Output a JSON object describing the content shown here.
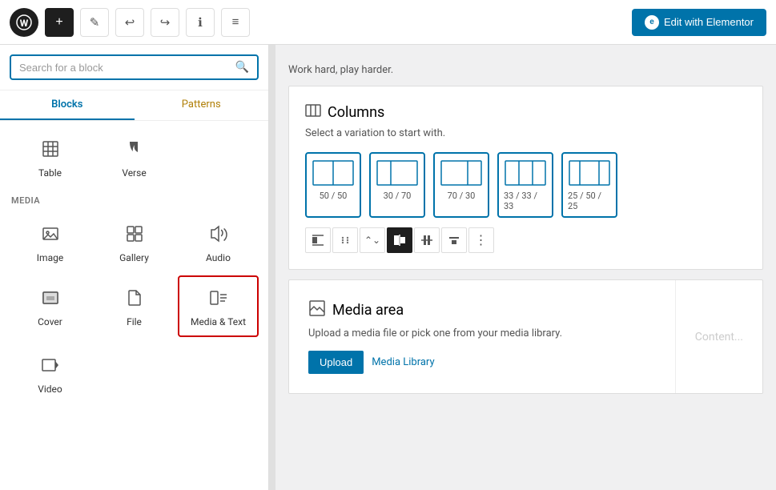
{
  "topbar": {
    "logo": "W",
    "add_label": "+",
    "edit_icon": "✎",
    "undo_icon": "↩",
    "redo_icon": "↪",
    "info_icon": "ℹ",
    "tools_icon": "≡",
    "elementor_icon": "e",
    "edit_button_label": "Edit with Elementor"
  },
  "sidebar": {
    "search_placeholder": "Search for a block",
    "tabs": [
      {
        "label": "Blocks",
        "active": true
      },
      {
        "label": "Patterns",
        "active": false
      }
    ],
    "sections": [
      {
        "label": "",
        "blocks": [
          {
            "icon": "⊞",
            "label": "Table",
            "selected": false
          },
          {
            "icon": "✒",
            "label": "Verse",
            "selected": false
          }
        ]
      },
      {
        "label": "MEDIA",
        "blocks": [
          {
            "icon": "🖼",
            "label": "Image",
            "selected": false
          },
          {
            "icon": "🖼",
            "label": "Gallery",
            "selected": false
          },
          {
            "icon": "♪",
            "label": "Audio",
            "selected": false
          },
          {
            "icon": "⬛",
            "label": "Cover",
            "selected": false
          },
          {
            "icon": "📁",
            "label": "File",
            "selected": false
          },
          {
            "icon": "≡▮",
            "label": "Media & Text",
            "selected": true
          }
        ]
      },
      {
        "label": "",
        "blocks": [
          {
            "icon": "▶",
            "label": "Video",
            "selected": false
          }
        ]
      }
    ]
  },
  "canvas": {
    "intro_text": "Work hard, play harder.",
    "columns_block": {
      "title": "Columns",
      "subtitle": "Select a variation to start with.",
      "options": [
        {
          "label": "50 / 50",
          "ratio": [
            1,
            1
          ]
        },
        {
          "label": "30 / 70",
          "ratio": [
            0.43,
            1
          ]
        },
        {
          "label": "70 / 30",
          "ratio": [
            1,
            0.43
          ]
        },
        {
          "label": "33 / 33 / 33",
          "ratio": [
            0.67,
            0.67,
            0.67
          ]
        },
        {
          "label": "25 / 50 / 25",
          "ratio": [
            0.5,
            1,
            0.5
          ]
        }
      ],
      "toolbar_buttons": [
        {
          "icon": "⬛",
          "active": false,
          "label": "align-left"
        },
        {
          "icon": "⁞⁞",
          "active": false,
          "label": "grip"
        },
        {
          "icon": "∧∨",
          "active": false,
          "label": "up-down"
        },
        {
          "icon": "⬛",
          "active": true,
          "label": "align-content"
        },
        {
          "icon": "⬛",
          "active": false,
          "label": "align-wide"
        },
        {
          "icon": "⬛",
          "active": false,
          "label": "text-top"
        },
        {
          "icon": "⋮",
          "active": false,
          "label": "more"
        }
      ]
    },
    "media_block": {
      "icon": "📋",
      "title": "Media area",
      "description": "Upload a media file or pick one from your media library.",
      "upload_label": "Upload",
      "library_label": "Media Library",
      "content_placeholder": "Content..."
    }
  }
}
